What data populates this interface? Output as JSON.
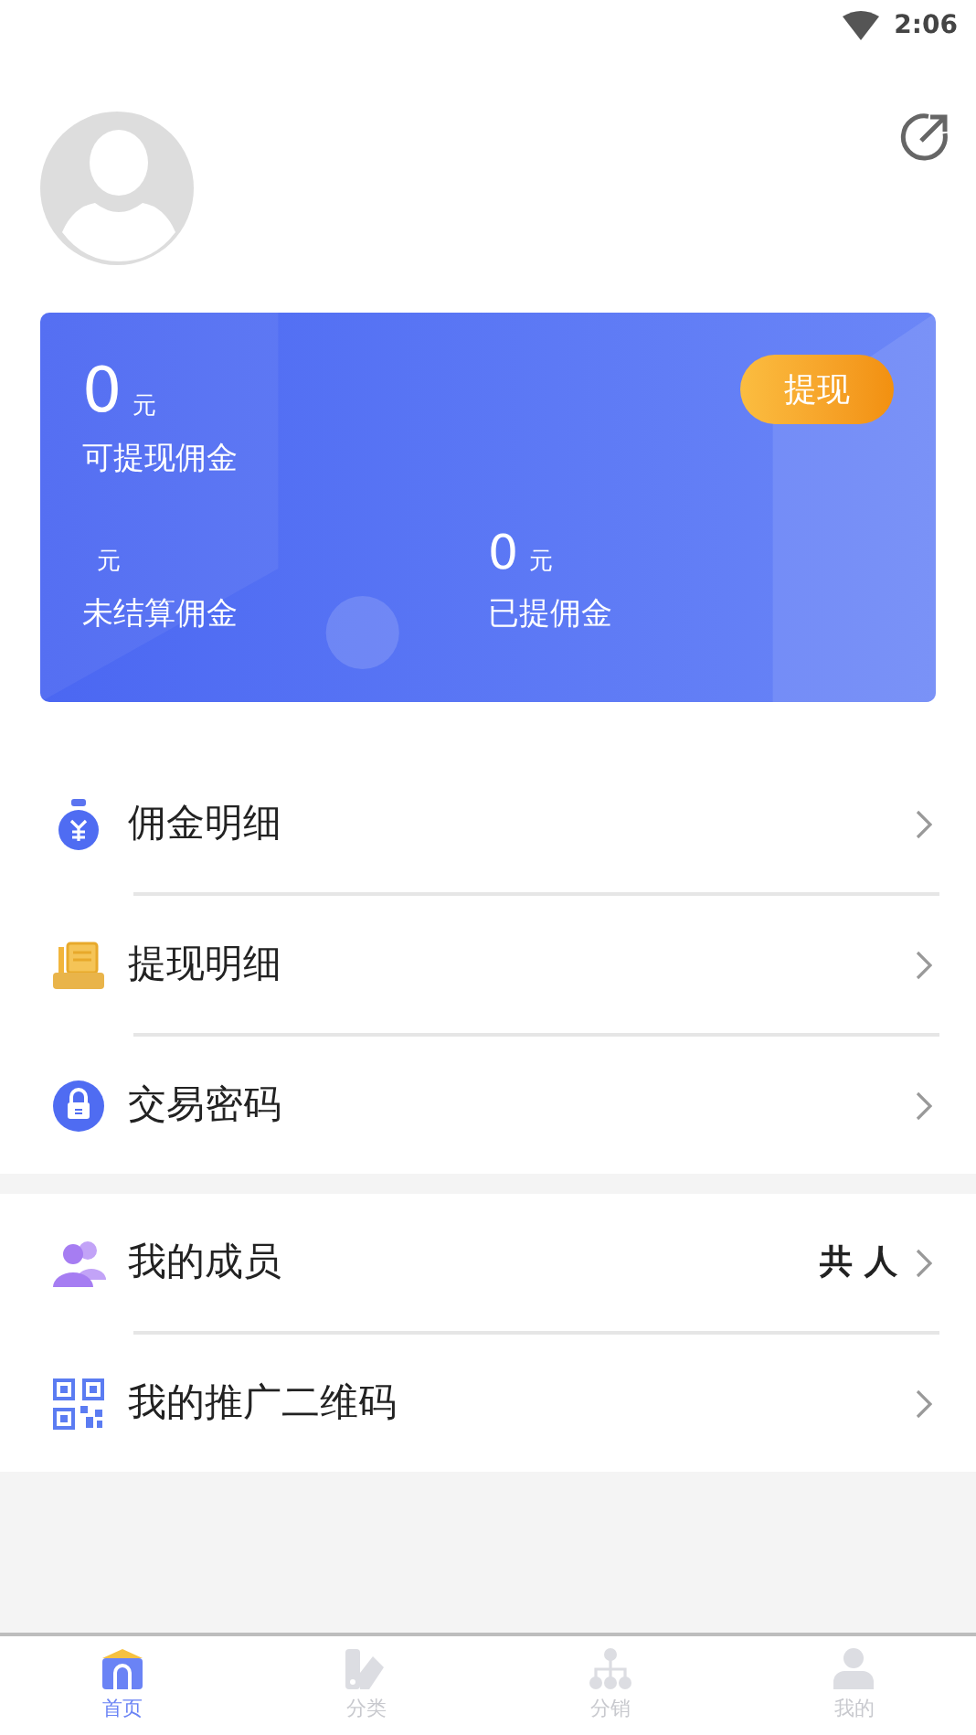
{
  "status_bar": {
    "time": "2:06"
  },
  "card": {
    "withdraw_button": "提现",
    "balances": [
      {
        "amount": "0",
        "unit": "元",
        "label": "可提现佣金"
      },
      {
        "unit": "元",
        "label": "未结算佣金"
      },
      {
        "amount": "0",
        "unit": "元",
        "label": "已提佣金"
      }
    ]
  },
  "menu_groups": [
    {
      "items": [
        {
          "kind": "money",
          "label": "佣金明细"
        },
        {
          "kind": "document",
          "label": "提现明细"
        },
        {
          "kind": "lock",
          "label": "交易密码"
        }
      ]
    },
    {
      "items": [
        {
          "kind": "members",
          "label": "我的成员",
          "value": "共 人"
        },
        {
          "kind": "qr",
          "label": "我的推广二维码"
        }
      ]
    }
  ],
  "tab_bar": [
    {
      "kind": "home",
      "label": "首页",
      "selected": true
    },
    {
      "kind": "category",
      "label": "分类",
      "selected": false
    },
    {
      "kind": "distribution",
      "label": "分销",
      "selected": false
    },
    {
      "kind": "profile",
      "label": "我的",
      "selected": false
    }
  ]
}
